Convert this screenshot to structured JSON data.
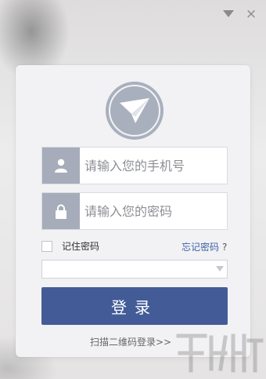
{
  "window": {
    "minimize_icon": "triangle-down-icon",
    "close_label": "×"
  },
  "logo": {
    "icon": "paper-plane-icon"
  },
  "phone": {
    "placeholder": "请输入您的手机号",
    "icon": "user-icon"
  },
  "password": {
    "placeholder": "请输入您的密码",
    "icon": "lock-icon"
  },
  "remember": {
    "label": "记住密码",
    "checked": false
  },
  "forgot": {
    "label": "忘记密码",
    "qmark": "?"
  },
  "account_select": {
    "value": ""
  },
  "login": {
    "label": "登录"
  },
  "qr": {
    "label": "扫描二维码登录>>"
  },
  "colors": {
    "primary": "#435c98",
    "icon_bg": "#a6acb9",
    "link": "#3f62a8"
  }
}
